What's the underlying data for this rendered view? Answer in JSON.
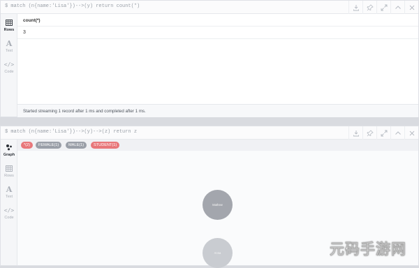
{
  "panel1": {
    "command": "$ match (n{name:'Lisa'})-->(y) return count(*)",
    "sidebar": [
      {
        "label": "Rows",
        "icon": "table-icon",
        "active": true
      },
      {
        "label": "Text",
        "icon": "text-icon",
        "active": false
      },
      {
        "label": "Code",
        "icon": "code-icon",
        "active": false
      }
    ],
    "table": {
      "columns": [
        "count(*)"
      ],
      "rows": [
        [
          "3"
        ]
      ]
    },
    "status": "Started streaming 1 record after 1 ms and completed after 1 ms."
  },
  "panel2": {
    "command": "$ match (n{name:'Lisa'})-->(y)-->(z) return z",
    "sidebar": [
      {
        "label": "Graph",
        "icon": "graph-icon",
        "active": true
      },
      {
        "label": "Rows",
        "icon": "table-icon",
        "active": false
      },
      {
        "label": "Text",
        "icon": "text-icon",
        "active": false
      },
      {
        "label": "Code",
        "icon": "code-icon",
        "active": false
      }
    ],
    "labels": [
      {
        "text": "*(2)",
        "color": "#e8777a"
      },
      {
        "text": "FEMALE(1)",
        "color": "#9a9fa8"
      },
      {
        "text": "MALE(1)",
        "color": "#9a9fa8"
      },
      {
        "text": "STUDENT(1)",
        "color": "#e8777a"
      }
    ],
    "nodes": [
      {
        "caption": "Mathew",
        "color": "#a3a6ad"
      },
      {
        "caption": "Anna",
        "color": "#c9ccd1"
      }
    ]
  },
  "actions": [
    "download-icon",
    "pin-icon",
    "expand-icon",
    "collapse-icon",
    "close-icon"
  ],
  "watermark": "元码手游网"
}
